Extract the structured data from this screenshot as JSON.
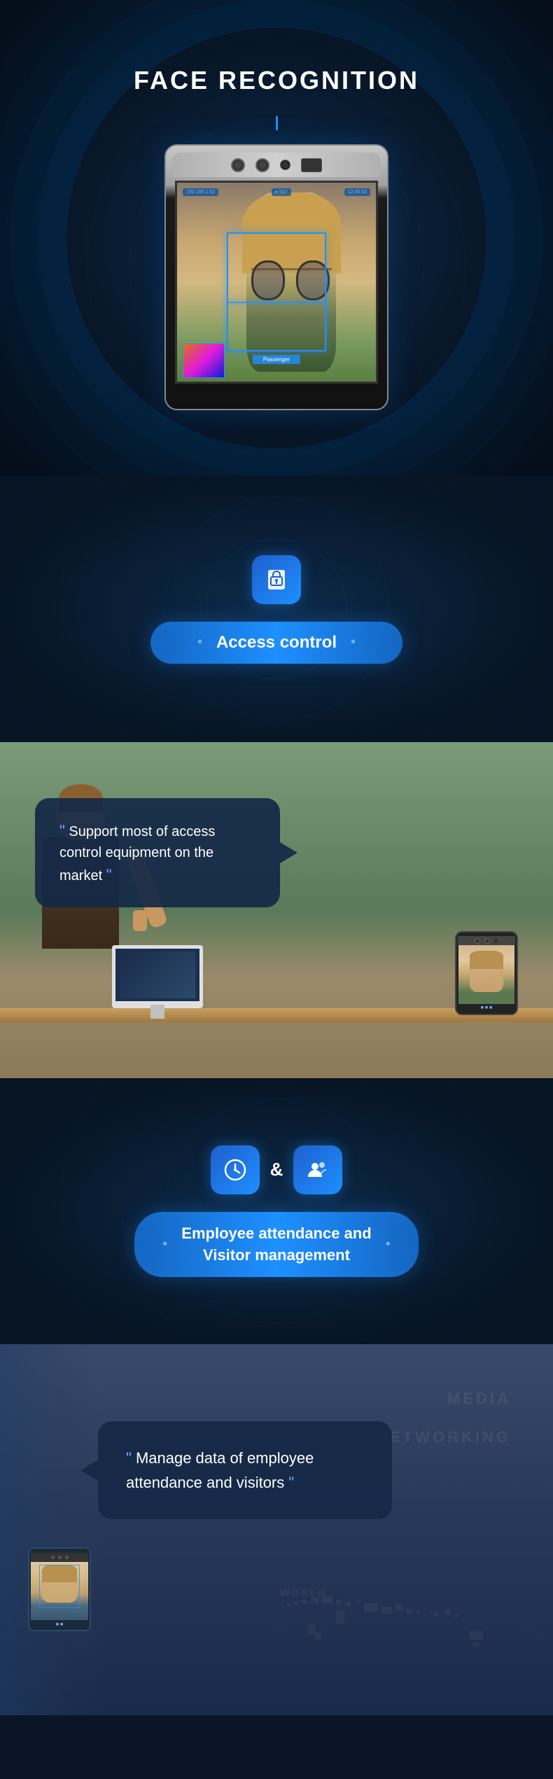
{
  "hero": {
    "title": "FACE RECOGNITION",
    "screen_name_bar": "Passenger",
    "hud_left": "192.168.1.52",
    "hud_mid": "● 547",
    "hud_right": "12:45:53"
  },
  "access_control": {
    "icon": "🔒",
    "label": "Access control",
    "dot_left": "•",
    "dot_right": "•"
  },
  "access_detail": {
    "quote_open": "\"",
    "text": "Support most of access control equipment on the market",
    "quote_close": "\""
  },
  "attendance": {
    "icon_left": "🕐",
    "icon_right": "👥",
    "amp": "&",
    "label": "Employee attendance and Visitor management",
    "dot_left": "•",
    "dot_right": "•"
  },
  "manage": {
    "quote_open": "\"",
    "text": "Manage data of employee attendance and visitors",
    "quote_close": "\"",
    "bg_text_line1": "MEDIA",
    "bg_text_line2": "NETWORKING",
    "bg_text_line3": "WORLD"
  }
}
